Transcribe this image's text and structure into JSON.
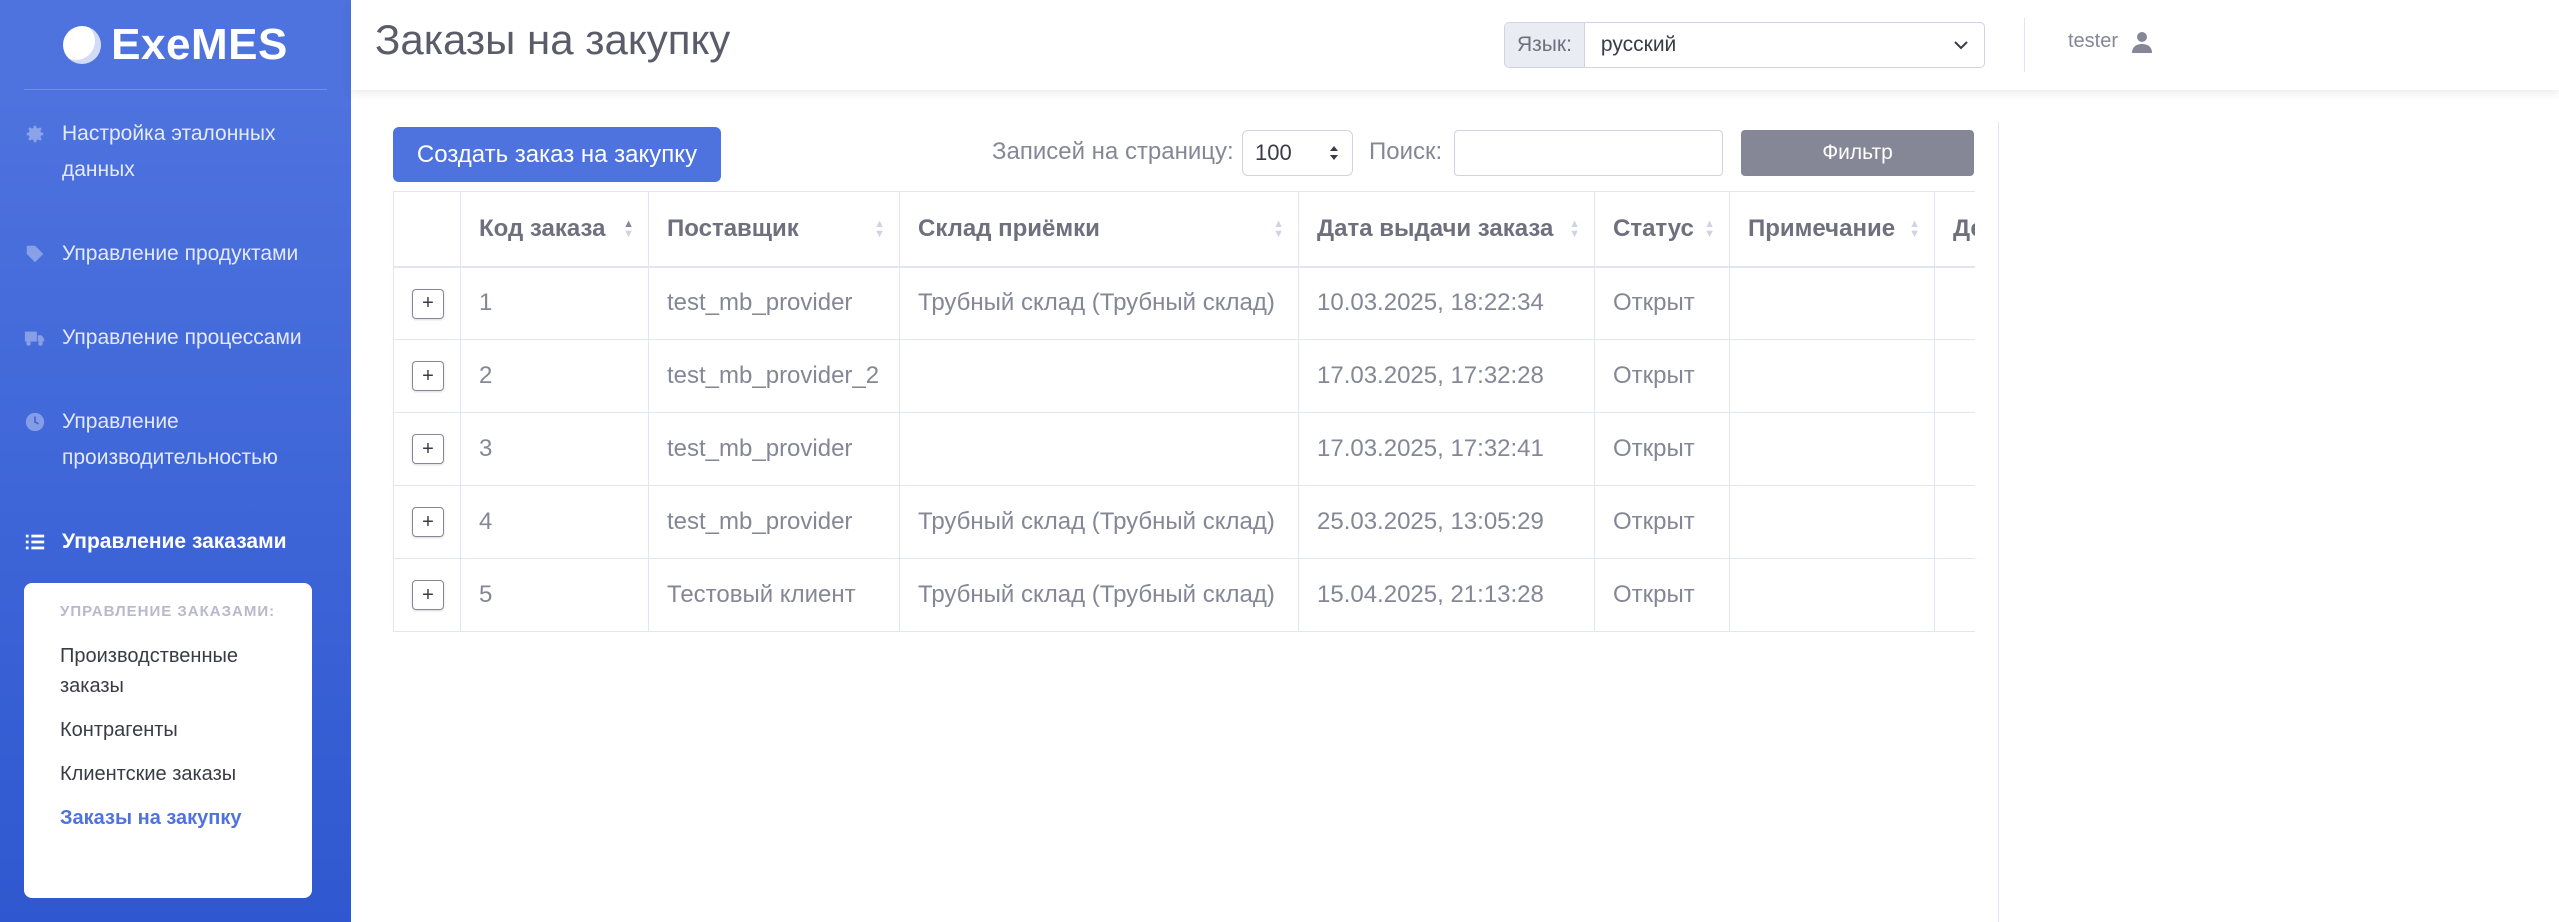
{
  "brand": {
    "name": "ExeMES"
  },
  "sidebar": {
    "items": [
      {
        "label": "Настройка эталонных данных",
        "icon": "gear-icon"
      },
      {
        "label": "Управление продуктами",
        "icon": "tag-icon"
      },
      {
        "label": "Управление процессами",
        "icon": "truck-icon"
      },
      {
        "label": "Управление производительностью",
        "icon": "clock-icon"
      },
      {
        "label": "Управление заказами",
        "icon": "list-icon"
      }
    ],
    "submenu": {
      "header": "УПРАВЛЕНИЕ ЗАКАЗАМИ:",
      "items": [
        {
          "label": "Производственные заказы"
        },
        {
          "label": "Контрагенты"
        },
        {
          "label": "Клиентские заказы"
        },
        {
          "label": "Заказы на закупку"
        }
      ]
    }
  },
  "topbar": {
    "title": "Заказы на закупку",
    "lang_label": "Язык:",
    "lang_value": "русский",
    "user_name": "tester"
  },
  "toolbar": {
    "create_label": "Создать заказ на закупку",
    "perpage_label": "Записей на страницу:",
    "perpage_value": "100",
    "search_label": "Поиск:",
    "filter_label": "Фильтр"
  },
  "table": {
    "columns": [
      "",
      "Код заказа",
      "Поставщик",
      "Склад приёмки",
      "Дата выдачи заказа",
      "Статус",
      "Примечание",
      "Де"
    ],
    "rows": [
      {
        "expand": "+",
        "code": "1",
        "provider": "test_mb_provider",
        "warehouse": "Трубный склад (Трубный склад)",
        "date": "10.03.2025, 18:22:34",
        "status": "Открыт",
        "note": ""
      },
      {
        "expand": "+",
        "code": "2",
        "provider": "test_mb_provider_2",
        "warehouse": "",
        "date": "17.03.2025, 17:32:28",
        "status": "Открыт",
        "note": ""
      },
      {
        "expand": "+",
        "code": "3",
        "provider": "test_mb_provider",
        "warehouse": "",
        "date": "17.03.2025, 17:32:41",
        "status": "Открыт",
        "note": ""
      },
      {
        "expand": "+",
        "code": "4",
        "provider": "test_mb_provider",
        "warehouse": "Трубный склад (Трубный склад)",
        "date": "25.03.2025, 13:05:29",
        "status": "Открыт",
        "note": ""
      },
      {
        "expand": "+",
        "code": "5",
        "provider": "Тестовый клиент",
        "warehouse": "Трубный склад (Трубный склад)",
        "date": "15.04.2025, 21:13:28",
        "status": "Открыт",
        "note": ""
      }
    ]
  },
  "colors": {
    "primary": "#4e73df",
    "secondary": "#858796"
  }
}
